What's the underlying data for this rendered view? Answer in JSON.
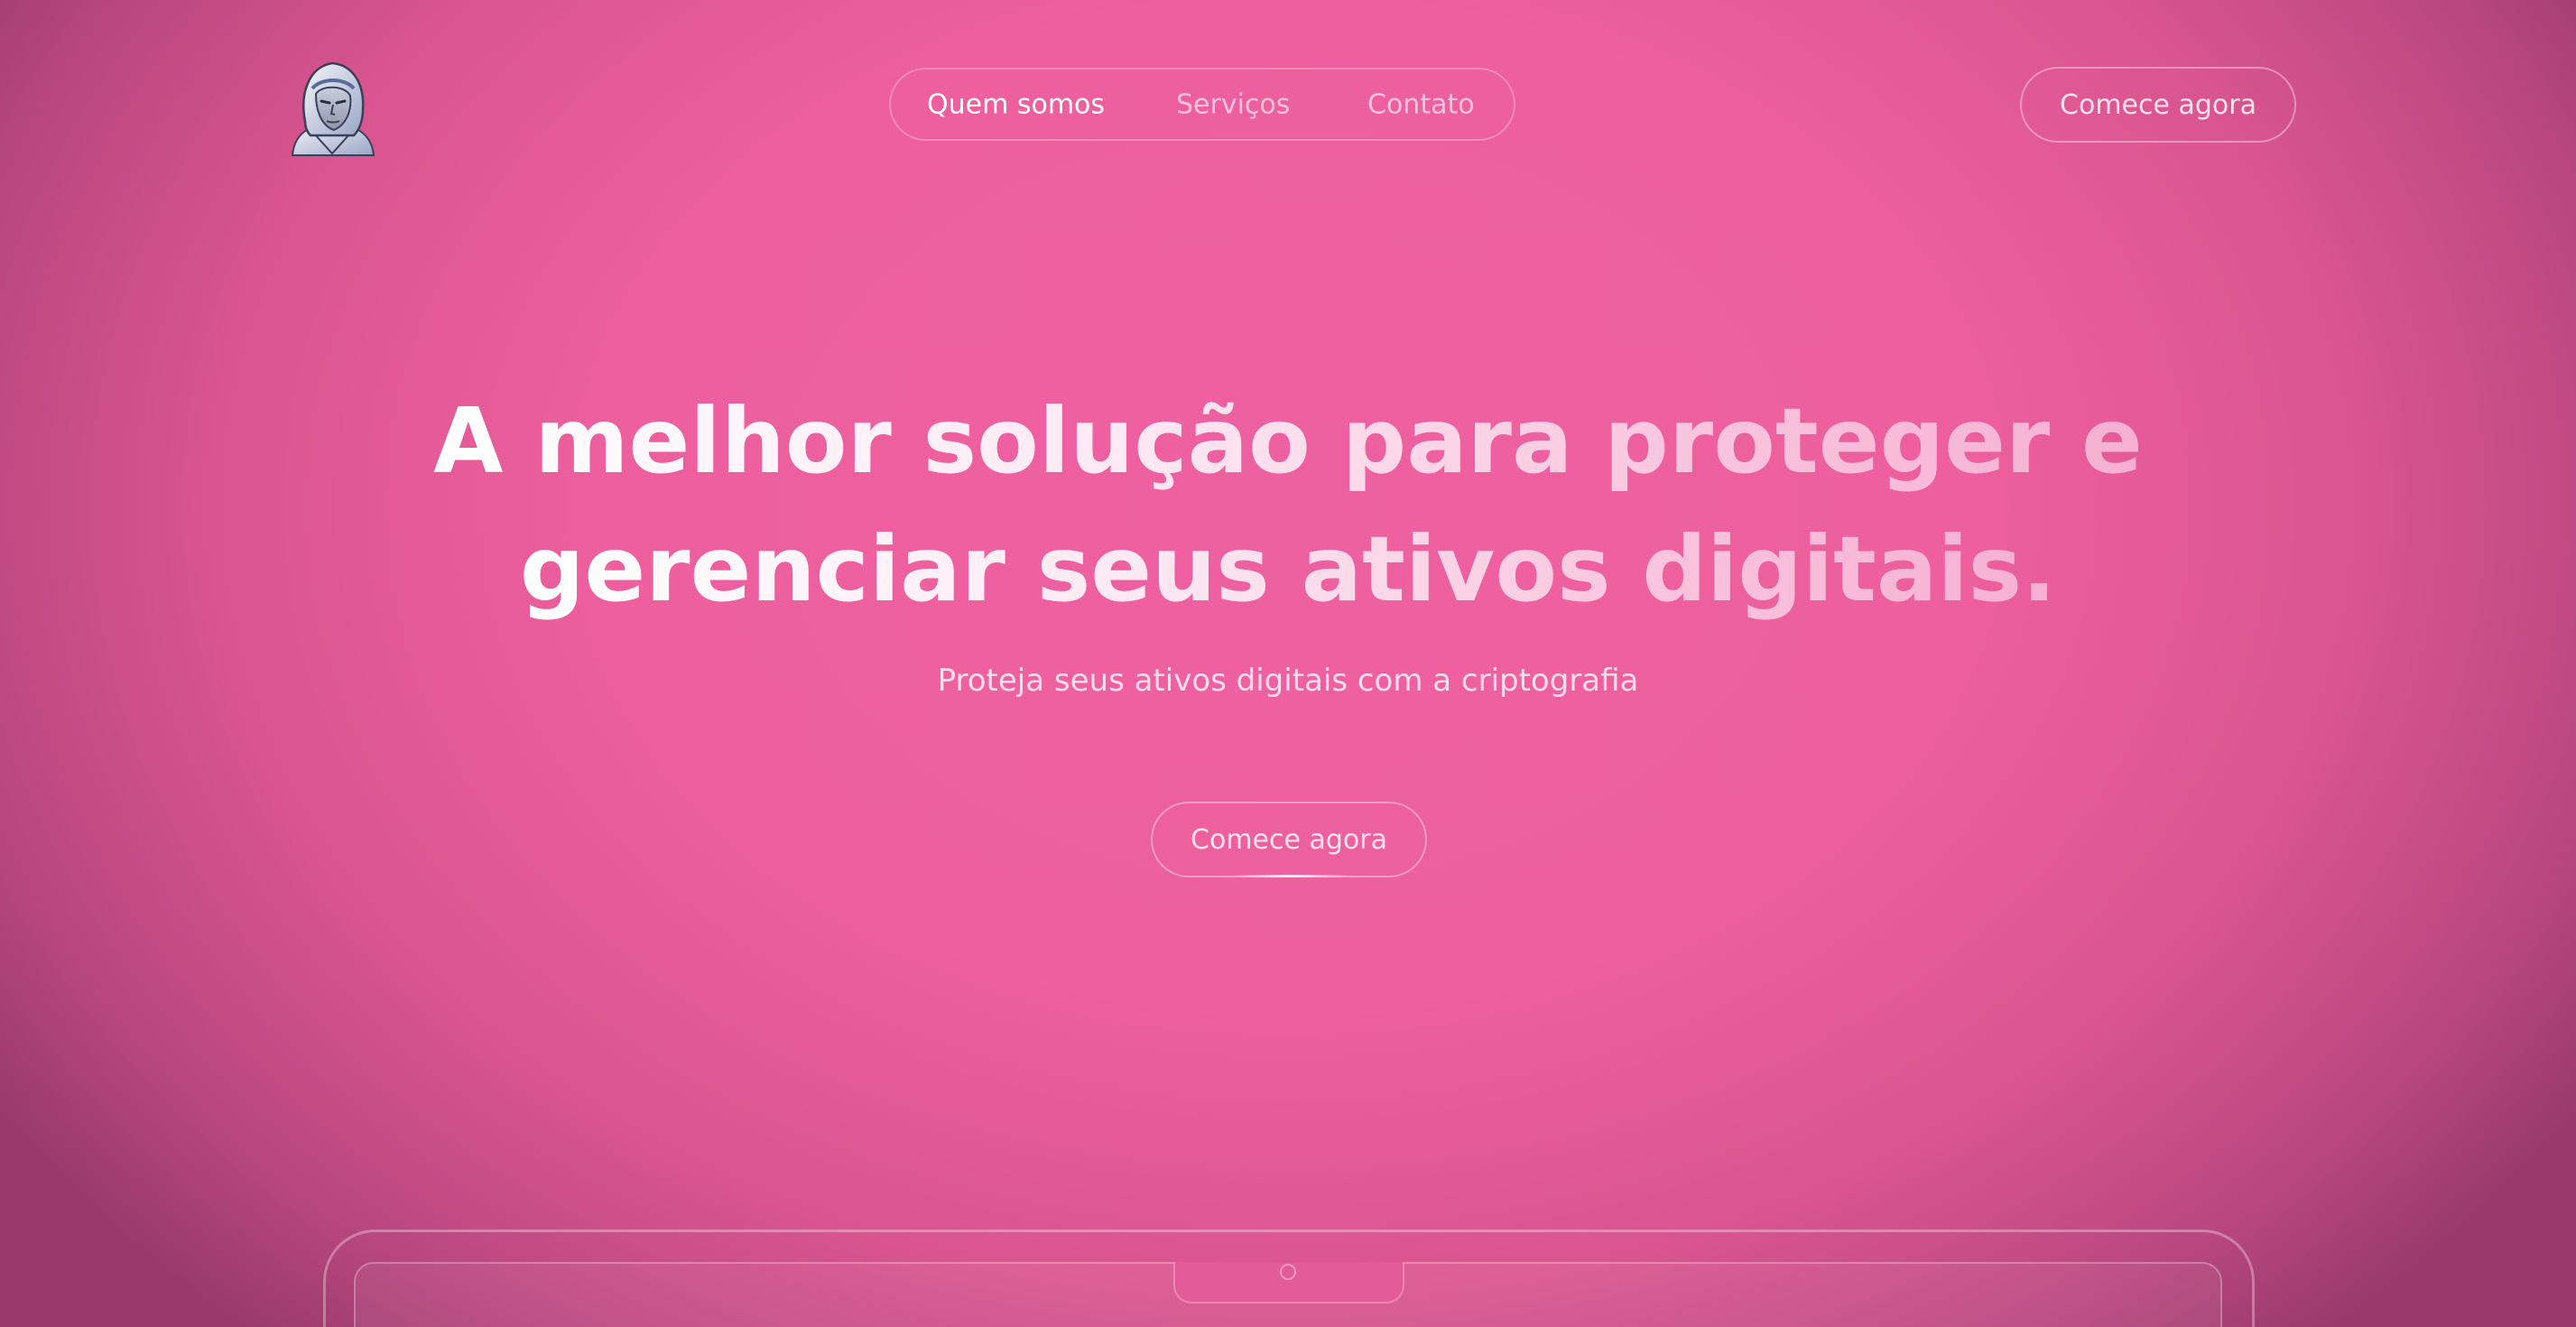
{
  "header": {
    "logo_icon": "hooded-figure-avatar-icon",
    "nav": [
      {
        "label": "Quem somos",
        "active": true
      },
      {
        "label": "Serviços",
        "active": false
      },
      {
        "label": "Contato",
        "active": false
      }
    ],
    "cta_label": "Comece agora"
  },
  "hero": {
    "title_line_1": "A melhor solução para proteger e",
    "title_line_2": "gerenciar seus ativos digitais.",
    "subtitle": "Proteja seus ativos digitais com a criptografia",
    "cta_label": "Comece agora"
  },
  "device_mockup": {
    "icon": "laptop-mockup-icon"
  },
  "colors": {
    "background": "#ed5f9d",
    "background_edge": "#983a6c",
    "text_primary": "#ffffff",
    "title_gradient_end": "#f6b0d2"
  }
}
